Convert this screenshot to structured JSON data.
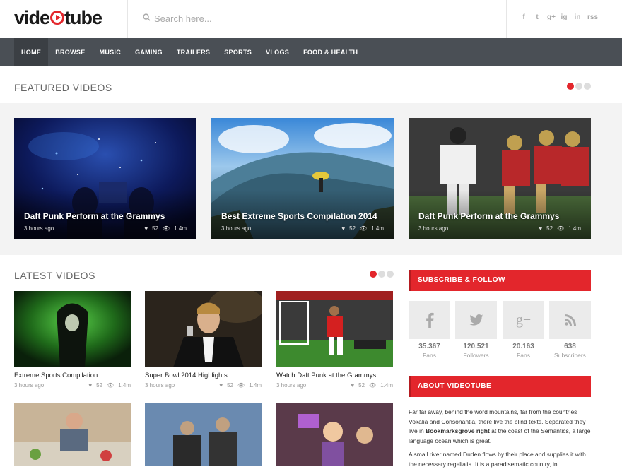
{
  "logo": {
    "part1": "vide",
    "part2": "tube"
  },
  "search": {
    "placeholder": "Search here..."
  },
  "social": [
    "f",
    "t",
    "g+",
    "ig",
    "in",
    "rss"
  ],
  "nav": [
    "HOME",
    "BROWSE",
    "MUSIC",
    "GAMING",
    "TRAILERS",
    "SPORTS",
    "VLOGS",
    "FOOD & HEALTH"
  ],
  "featured": {
    "title": "FEATURED VIDEOS",
    "items": [
      {
        "title": "Daft Punk Perform at the Grammys",
        "time": "3 hours ago",
        "likes": "52",
        "views": "1.4m"
      },
      {
        "title": "Best Extreme Sports Compilation 2014",
        "time": "3 hours ago",
        "likes": "52",
        "views": "1.4m"
      },
      {
        "title": "Daft Punk Perform at the Grammys",
        "time": "3 hours ago",
        "likes": "52",
        "views": "1.4m"
      }
    ]
  },
  "latest": {
    "title": "LATEST VIDEOS",
    "items": [
      {
        "title": "Extreme Sports Compilation",
        "time": "3 hours ago",
        "likes": "52",
        "views": "1.4m"
      },
      {
        "title": "Super Bowl 2014 Highlights",
        "time": "3 hours ago",
        "likes": "52",
        "views": "1.4m"
      },
      {
        "title": "Watch Daft Punk at the Grammys",
        "time": "3 hours ago",
        "likes": "52",
        "views": "1.4m"
      }
    ]
  },
  "subscribe": {
    "title": "SUBSCRIBE & FOLLOW",
    "stats": [
      {
        "icon": "facebook-icon",
        "num": "35.367",
        "label": "Fans"
      },
      {
        "icon": "twitter-icon",
        "num": "120.521",
        "label": "Followers"
      },
      {
        "icon": "googleplus-icon",
        "num": "20.163",
        "label": "Fans"
      },
      {
        "icon": "rss-icon",
        "num": "638",
        "label": "Subscribers"
      }
    ]
  },
  "about": {
    "title": "ABOUT VIDEOTUBE",
    "p1a": "Far far away, behind the word mountains, far from the countries Vokalia and Consonantia, there live the blind texts. Separated they live in ",
    "p1b": "Bookmarksgrove right",
    "p1c": " at the coast of the Semantics, a large language ocean which is great.",
    "p2": "A small river named Duden flows by their place and supplies it with the necessary regelialia. It is a paradisematic country, in"
  },
  "colors": {
    "accent": "#e3262c",
    "nav": "#4a4f55"
  }
}
